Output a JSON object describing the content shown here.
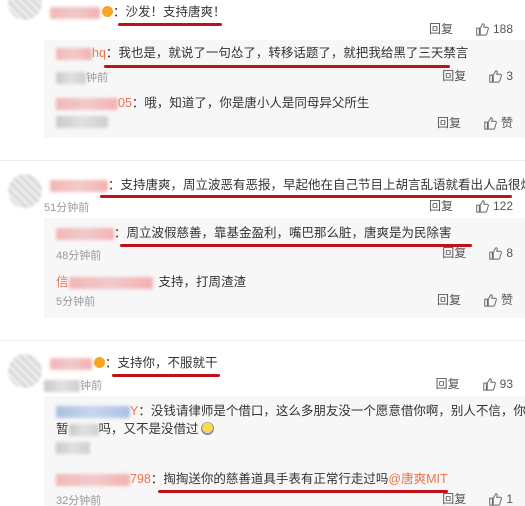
{
  "actions": {
    "reply_label": "回复",
    "like_label": "赞"
  },
  "comments": [
    {
      "text": "：沙发！支持唐爽！",
      "likes": "188"
    },
    {
      "name_suffix": "hq",
      "text": "：我也是，就说了一句怂了，转移话题了，就把我给黑了三天禁言",
      "time": "钟前",
      "likes": "3"
    },
    {
      "name_suffix": "05",
      "text": "：哦，知道了，你是唐小人是同母异父所生",
      "time": ""
    },
    {
      "text": "：支持唐爽，周立波恶有恶报，早起他在自己节目上胡言乱语就看出人品很烂",
      "time": "51分钟前",
      "likes": "122"
    },
    {
      "text": "：周立波假慈善，靠基金盈利，嘴巴那么脏，唐爽是为民除害",
      "time": "48分钟前",
      "likes": "8"
    },
    {
      "name_prefix": "信",
      "text": "支持，打周渣渣",
      "time": "5分钟前"
    },
    {
      "text": "：支持你，不服就干",
      "time": "钟前",
      "likes": "93"
    },
    {
      "name_suffix": "Y",
      "text": "：没钱请律师是个借口，这么多朋友没一个愿意借你啊，别人不信，你",
      "text2": "吗，又不是没借过",
      "text2_prefix": "暂"
    },
    {
      "name_suffix": "798",
      "text": "：掏掏送你的慈善道具手表有正常行走过吗",
      "mention": "@唐爽MIT",
      "time": "32分钟前",
      "likes": "1"
    }
  ]
}
